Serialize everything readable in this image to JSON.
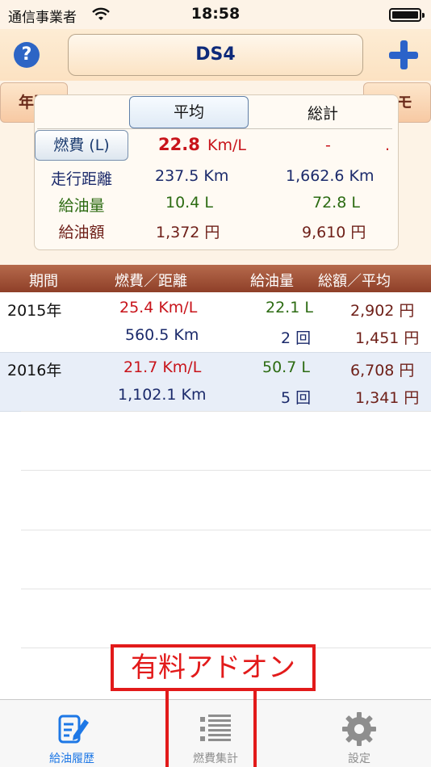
{
  "status": {
    "carrier": "通信事業者",
    "time": "18:58"
  },
  "nav": {
    "title": "DS4",
    "year_button": "年別",
    "memo_button": "メモ"
  },
  "summary": {
    "tab_average": "平均",
    "tab_total": "総計",
    "rows": [
      {
        "label": "燃費 (L)",
        "avg_num": "22.8",
        "avg_unit": "Km/L",
        "total": "-",
        "total_dot": "."
      },
      {
        "label": "走行距離",
        "avg": "237.5 Km",
        "total": "1,662.6 Km"
      },
      {
        "label": "給油量",
        "avg": "10.4 L",
        "total": "72.8 L"
      },
      {
        "label": "給油額",
        "avg": "1,372 円",
        "total": "9,610 円"
      }
    ]
  },
  "list": {
    "headers": {
      "period": "期間",
      "fuel_distance": "燃費／距離",
      "fuel_amount": "給油量",
      "sum_avg": "総額／平均"
    },
    "rows": [
      {
        "year": "2015年",
        "efficiency": "25.4 Km/L",
        "distance": "560.5 Km",
        "fuel": "22.1 L",
        "count": "2 回",
        "total_cost": "2,902 円",
        "avg_cost": "1,451 円"
      },
      {
        "year": "2016年",
        "efficiency": "21.7 Km/L",
        "distance": "1,102.1 Km",
        "fuel": "50.7 L",
        "count": "5 回",
        "total_cost": "6,708 円",
        "avg_cost": "1,341 円"
      }
    ]
  },
  "overlay": {
    "label": "有料アドオン"
  },
  "tabs": [
    {
      "label": "給油履歴",
      "icon": "edit-note-icon",
      "active": true
    },
    {
      "label": "燃費集計",
      "icon": "list-icon",
      "active": false
    },
    {
      "label": "設定",
      "icon": "gear-icon",
      "active": false
    }
  ],
  "colors": {
    "accent": "#2d65c5",
    "header_brown": "#9a4a30",
    "red": "#c8141b",
    "navy": "#1b2a6b",
    "green": "#2c6b12",
    "maroon": "#6e1f18"
  }
}
